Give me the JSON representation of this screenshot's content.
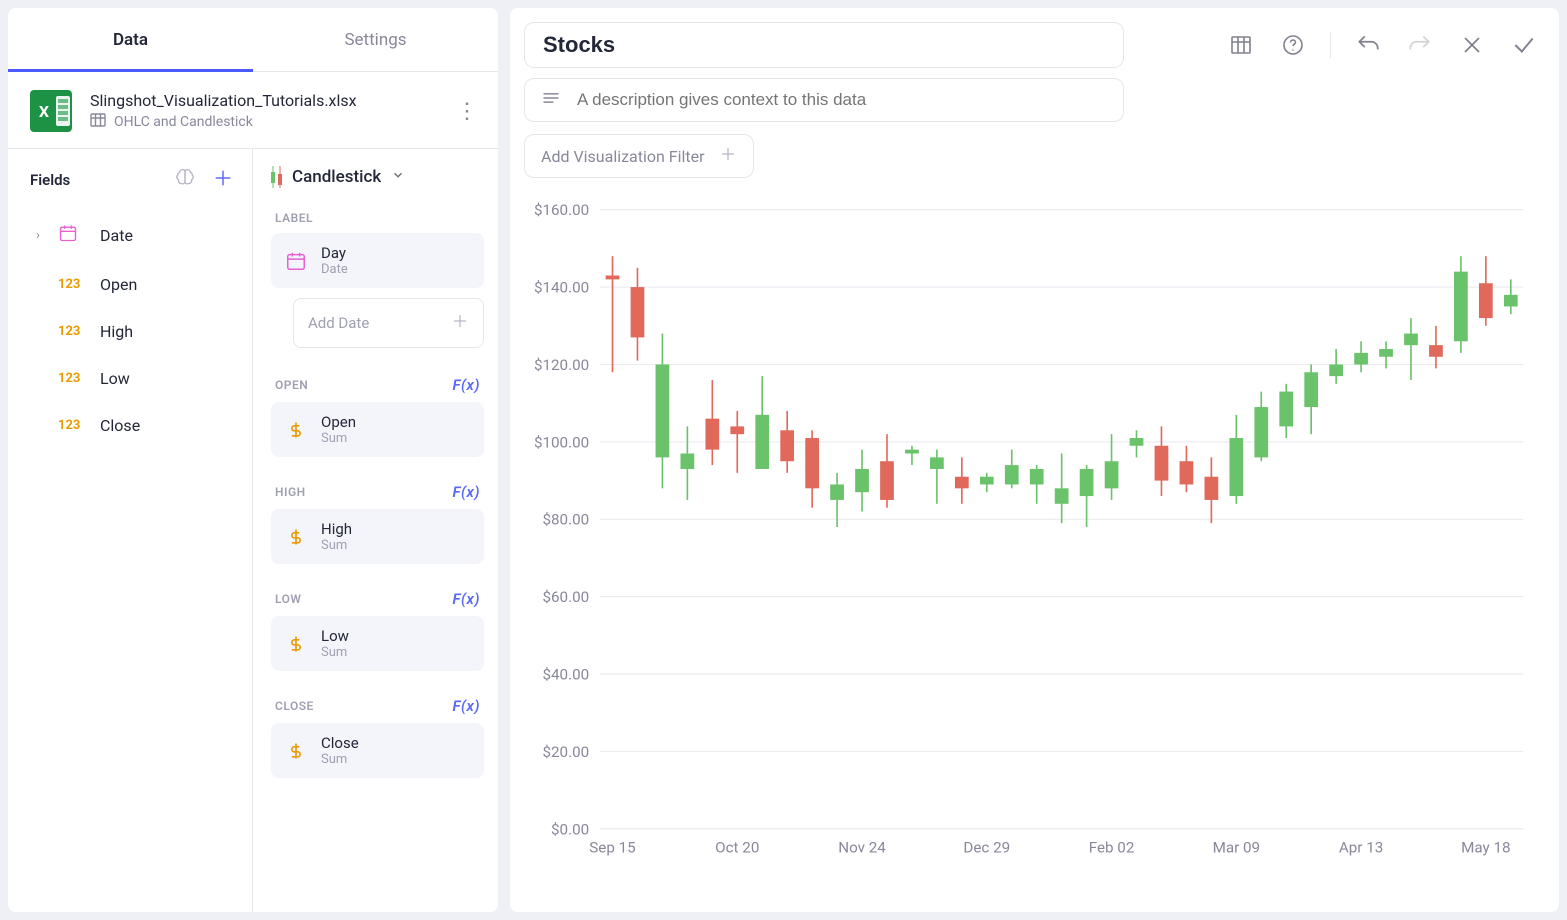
{
  "tabs": {
    "data": "Data",
    "settings": "Settings"
  },
  "datasource": {
    "filename": "Slingshot_Visualization_Tutorials.xlsx",
    "sheet": "OHLC and Candlestick"
  },
  "fields": {
    "header": "Fields",
    "items": [
      {
        "label": "Date",
        "type": "date",
        "expandable": true
      },
      {
        "label": "Open",
        "type": "num"
      },
      {
        "label": "High",
        "type": "num"
      },
      {
        "label": "Low",
        "type": "num"
      },
      {
        "label": "Close",
        "type": "num"
      }
    ]
  },
  "config": {
    "viz_name": "Candlestick",
    "label_section": "LABEL",
    "label_chip": {
      "title": "Day",
      "sub": "Date"
    },
    "add_date_placeholder": "Add Date",
    "fx_label": "F(x)",
    "sections": [
      {
        "key": "OPEN",
        "chip_title": "Open",
        "chip_sub": "Sum"
      },
      {
        "key": "HIGH",
        "chip_title": "High",
        "chip_sub": "Sum"
      },
      {
        "key": "LOW",
        "chip_title": "Low",
        "chip_sub": "Sum"
      },
      {
        "key": "CLOSE",
        "chip_title": "Close",
        "chip_sub": "Sum"
      }
    ]
  },
  "viz": {
    "title": "Stocks",
    "description_placeholder": "A description gives context to this data",
    "add_filter": "Add Visualization Filter"
  },
  "chart_data": {
    "type": "candlestick",
    "ylabel": "",
    "ylim": [
      0,
      160
    ],
    "y_ticks": [
      0.0,
      20.0,
      40.0,
      60.0,
      80.0,
      100.0,
      120.0,
      140.0,
      160.0
    ],
    "y_tick_format": "$%.2f",
    "x_ticks": [
      "Sep 15",
      "Oct 20",
      "Nov 24",
      "Dec 29",
      "Feb 02",
      "Mar 09",
      "Apr 13",
      "May 18"
    ],
    "candles": [
      {
        "i": 0,
        "open": 143,
        "high": 148,
        "low": 118,
        "close": 142
      },
      {
        "i": 1,
        "open": 140,
        "high": 145,
        "low": 121,
        "close": 127
      },
      {
        "i": 2,
        "open": 96,
        "high": 128,
        "low": 88,
        "close": 120
      },
      {
        "i": 3,
        "open": 93,
        "high": 104,
        "low": 85,
        "close": 97
      },
      {
        "i": 4,
        "open": 106,
        "high": 116,
        "low": 94,
        "close": 98
      },
      {
        "i": 5,
        "open": 104,
        "high": 108,
        "low": 92,
        "close": 102
      },
      {
        "i": 6,
        "open": 93,
        "high": 117,
        "low": 93,
        "close": 107
      },
      {
        "i": 7,
        "open": 103,
        "high": 108,
        "low": 92,
        "close": 95
      },
      {
        "i": 8,
        "open": 101,
        "high": 103,
        "low": 83,
        "close": 88
      },
      {
        "i": 9,
        "open": 85,
        "high": 92,
        "low": 78,
        "close": 89
      },
      {
        "i": 10,
        "open": 87,
        "high": 98,
        "low": 82,
        "close": 93
      },
      {
        "i": 11,
        "open": 95,
        "high": 102,
        "low": 83,
        "close": 85
      },
      {
        "i": 12,
        "open": 97,
        "high": 99,
        "low": 94,
        "close": 98
      },
      {
        "i": 13,
        "open": 93,
        "high": 98,
        "low": 84,
        "close": 96
      },
      {
        "i": 14,
        "open": 91,
        "high": 96,
        "low": 84,
        "close": 88
      },
      {
        "i": 15,
        "open": 89,
        "high": 92,
        "low": 87,
        "close": 91
      },
      {
        "i": 16,
        "open": 89,
        "high": 98,
        "low": 88,
        "close": 94
      },
      {
        "i": 17,
        "open": 89,
        "high": 94,
        "low": 84,
        "close": 93
      },
      {
        "i": 18,
        "open": 84,
        "high": 97,
        "low": 79,
        "close": 88
      },
      {
        "i": 19,
        "open": 86,
        "high": 94,
        "low": 78,
        "close": 93
      },
      {
        "i": 20,
        "open": 88,
        "high": 102,
        "low": 85,
        "close": 95
      },
      {
        "i": 21,
        "open": 99,
        "high": 103,
        "low": 96,
        "close": 101
      },
      {
        "i": 22,
        "open": 99,
        "high": 104,
        "low": 86,
        "close": 90
      },
      {
        "i": 23,
        "open": 95,
        "high": 99,
        "low": 87,
        "close": 89
      },
      {
        "i": 24,
        "open": 91,
        "high": 96,
        "low": 79,
        "close": 85
      },
      {
        "i": 25,
        "open": 86,
        "high": 107,
        "low": 84,
        "close": 101
      },
      {
        "i": 26,
        "open": 96,
        "high": 113,
        "low": 95,
        "close": 109
      },
      {
        "i": 27,
        "open": 104,
        "high": 115,
        "low": 101,
        "close": 113
      },
      {
        "i": 28,
        "open": 109,
        "high": 120,
        "low": 102,
        "close": 118
      },
      {
        "i": 29,
        "open": 117,
        "high": 124,
        "low": 115,
        "close": 120
      },
      {
        "i": 30,
        "open": 120,
        "high": 126,
        "low": 118,
        "close": 123
      },
      {
        "i": 31,
        "open": 122,
        "high": 126,
        "low": 119,
        "close": 124
      },
      {
        "i": 32,
        "open": 125,
        "high": 132,
        "low": 116,
        "close": 128
      },
      {
        "i": 33,
        "open": 125,
        "high": 130,
        "low": 119,
        "close": 122
      },
      {
        "i": 34,
        "open": 126,
        "high": 148,
        "low": 123,
        "close": 144
      },
      {
        "i": 35,
        "open": 141,
        "high": 148,
        "low": 130,
        "close": 132
      },
      {
        "i": 36,
        "open": 135,
        "high": 142,
        "low": 133,
        "close": 138
      }
    ]
  }
}
